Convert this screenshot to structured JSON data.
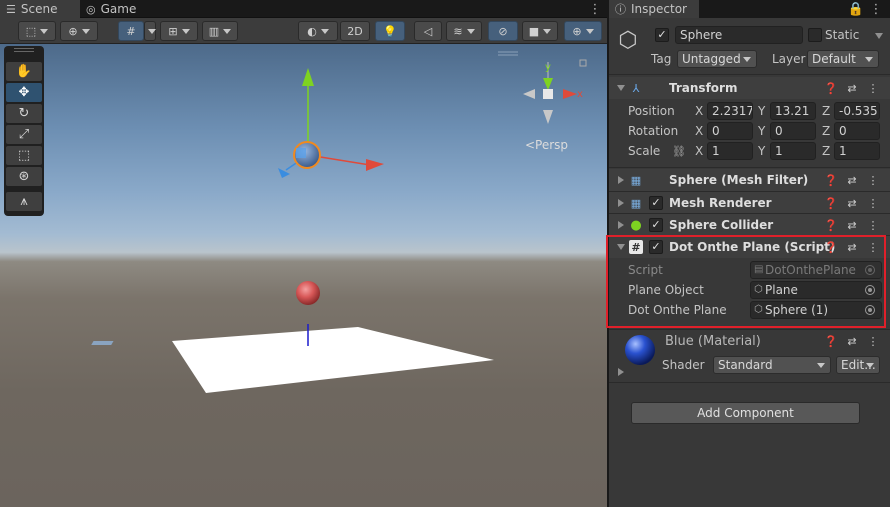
{
  "tabs": {
    "scene": "Scene",
    "game": "Game",
    "inspector": "Inspector"
  },
  "toolbar": {
    "mode_2d": "2D"
  },
  "viewport": {
    "persp": "<Persp"
  },
  "object": {
    "name": "Sphere",
    "static_label": "Static",
    "tag_label": "Tag",
    "tag_value": "Untagged",
    "layer_label": "Layer",
    "layer_value": "Default"
  },
  "transform": {
    "title": "Transform",
    "position_label": "Position",
    "rotation_label": "Rotation",
    "scale_label": "Scale",
    "axis_x": "X",
    "axis_y": "Y",
    "axis_z": "Z",
    "position": {
      "x": "2.2317",
      "y": "13.21",
      "z": "-0.535"
    },
    "rotation": {
      "x": "0",
      "y": "0",
      "z": "0"
    },
    "scale": {
      "x": "1",
      "y": "1",
      "z": "1"
    }
  },
  "components": {
    "mesh_filter": "Sphere (Mesh Filter)",
    "mesh_renderer": "Mesh Renderer",
    "sphere_collider": "Sphere Collider",
    "script": "Dot Onthe Plane (Script)"
  },
  "script_fields": {
    "script_label": "Script",
    "script_value": "DotOnthePlane",
    "plane_label": "Plane Object",
    "plane_value": "Plane",
    "dot_label": "Dot Onthe Plane",
    "dot_value": "Sphere (1)"
  },
  "material": {
    "name": "Blue (Material)",
    "shader_label": "Shader",
    "shader_value": "Standard",
    "edit_label": "Edit..."
  },
  "add_component": "Add Component",
  "colors": {
    "accent": "#46607c",
    "highlight": "#e0202a",
    "axis_x": "#e04a3a",
    "axis_y": "#7ed321",
    "axis_z": "#3a8de0"
  }
}
